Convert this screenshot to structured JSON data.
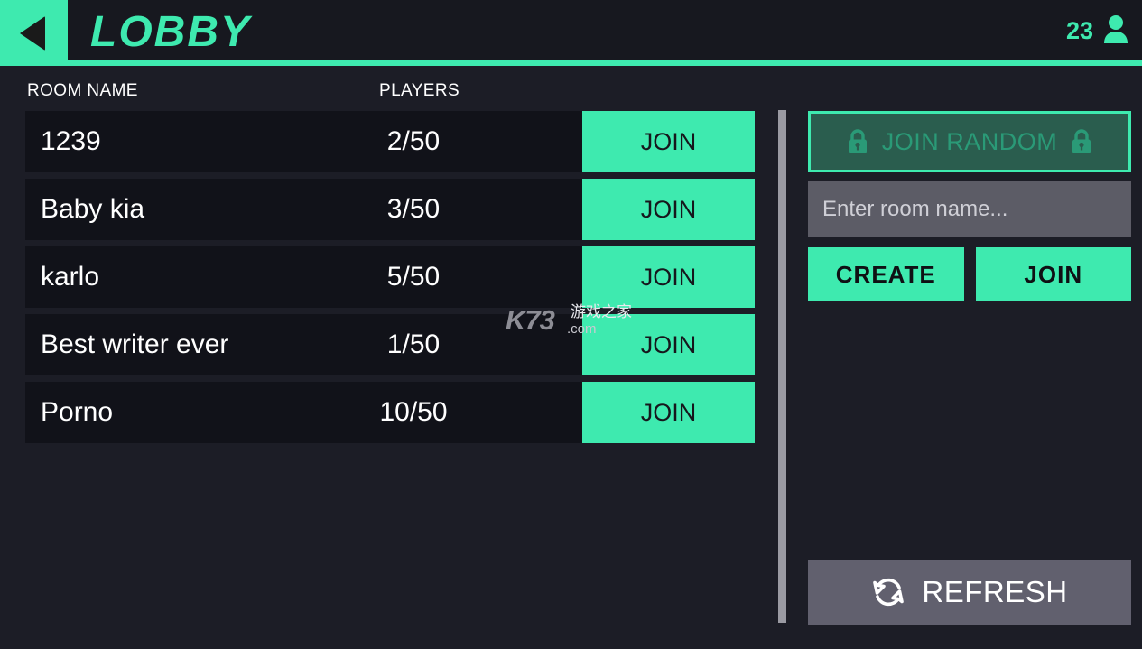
{
  "header": {
    "title": "LOBBY",
    "back_icon": "back-triangle-icon",
    "player_count": "23",
    "player_icon": "person-icon"
  },
  "list": {
    "columns": {
      "room_name": "ROOM NAME",
      "players": "PLAYERS"
    },
    "join_label": "JOIN",
    "rooms": [
      {
        "name": "1239",
        "players": "2/50"
      },
      {
        "name": "Baby kia",
        "players": "3/50"
      },
      {
        "name": "karlo",
        "players": "5/50"
      },
      {
        "name": "Best writer ever",
        "players": "1/50"
      },
      {
        "name": "Porno",
        "players": "10/50"
      }
    ]
  },
  "panel": {
    "join_random_label": "JOIN RANDOM",
    "lock_icon": "lock-icon",
    "room_name_value": "",
    "room_name_placeholder": "Enter room name...",
    "create_label": "CREATE",
    "join_label": "JOIN",
    "refresh_label": "REFRESH",
    "refresh_icon": "refresh-icon"
  },
  "watermark": {
    "brand": "K73",
    "domain": ".com",
    "chinese": "游戏之家"
  },
  "colors": {
    "accent": "#3eeaaf",
    "page_bg": "#1c1d26",
    "header_bg": "#17181f",
    "row_bg": "#111219",
    "input_bg": "#5c5c66",
    "refresh_bg": "#61606e",
    "join_random_bg": "#2a5d4e",
    "join_random_text": "#2a9a77"
  }
}
